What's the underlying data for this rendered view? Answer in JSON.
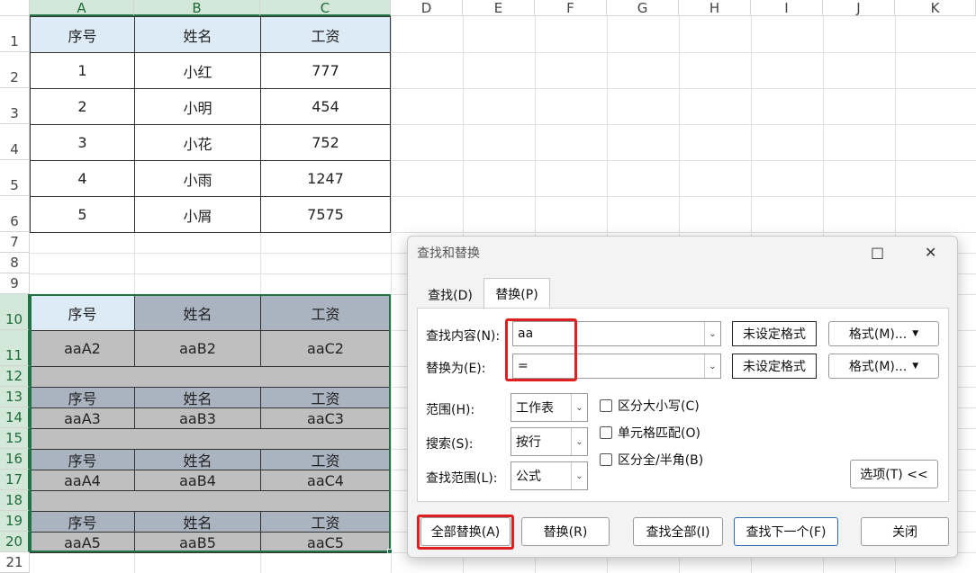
{
  "columns": [
    "A",
    "B",
    "C",
    "D",
    "E",
    "F",
    "G",
    "H",
    "I",
    "J",
    "K"
  ],
  "rows": [
    "1",
    "2",
    "3",
    "4",
    "5",
    "6",
    "7",
    "8",
    "9",
    "10",
    "11",
    "12",
    "13",
    "14",
    "15",
    "16",
    "17",
    "18",
    "19",
    "20",
    "21"
  ],
  "table1": {
    "headers": [
      "序号",
      "姓名",
      "工资"
    ],
    "rows": [
      [
        "1",
        "小红",
        "777"
      ],
      [
        "2",
        "小明",
        "454"
      ],
      [
        "3",
        "小花",
        "752"
      ],
      [
        "4",
        "小雨",
        "1247"
      ],
      [
        "5",
        "小屑",
        "7575"
      ]
    ]
  },
  "table2": {
    "header": [
      "序号",
      "姓名",
      "工资"
    ],
    "rows": [
      [
        "aaA2",
        "aaB2",
        "aaC2"
      ],
      [
        "aaA3",
        "aaB3",
        "aaC3"
      ],
      [
        "aaA4",
        "aaB4",
        "aaC4"
      ],
      [
        "aaA5",
        "aaB5",
        "aaC5"
      ]
    ]
  },
  "dialog": {
    "title": "查找和替换",
    "tab_find": "查找(D)",
    "tab_replace": "替换(P)",
    "find_label": "查找内容(N):",
    "find_value": "aa",
    "replace_label": "替换为(E):",
    "replace_value": "=",
    "no_format_1": "未设定格式",
    "no_format_2": "未设定格式",
    "format_btn_1": "格式(M)...",
    "format_btn_2": "格式(M)...",
    "scope_label": "范围(H):",
    "scope_value": "工作表",
    "search_label": "搜索(S):",
    "search_value": "按行",
    "lookin_label": "查找范围(L):",
    "lookin_value": "公式",
    "chk_case": "区分大小写(C)",
    "chk_cell": "单元格匹配(O)",
    "chk_width": "区分全/半角(B)",
    "options_btn": "选项(T) <<",
    "replace_all": "全部替换(A)",
    "replace": "替换(R)",
    "find_all": "查找全部(I)",
    "find_next": "查找下一个(F)",
    "close": "关闭",
    "icons": {
      "maximize": "square-icon",
      "close": "close-icon",
      "dropdown": "chevron-down-icon"
    }
  }
}
